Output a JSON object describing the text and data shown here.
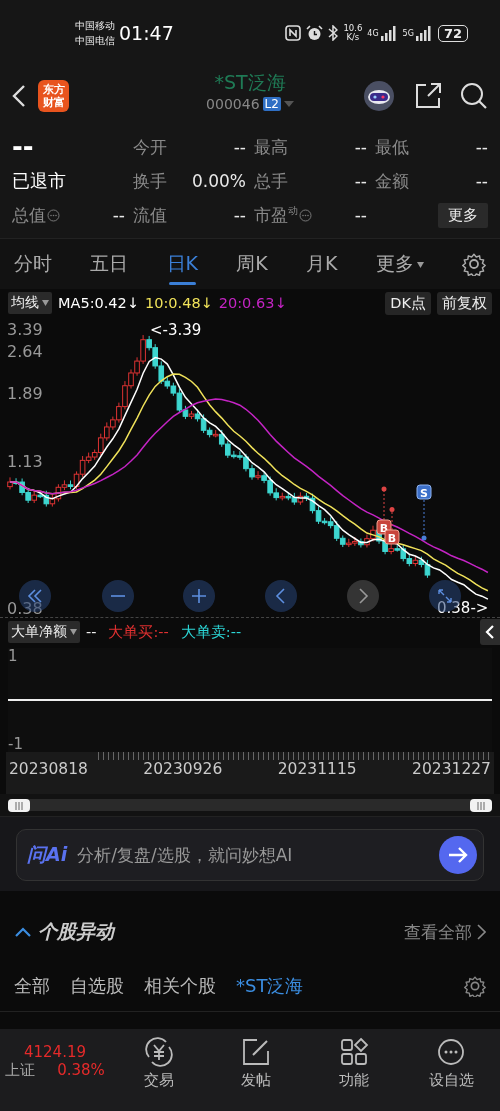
{
  "status_bar": {
    "carriers": [
      "中国移动",
      "中国电信"
    ],
    "time": "01:47",
    "net_speed": [
      "10.6",
      "K/s"
    ],
    "networks": [
      "4G",
      "5G"
    ],
    "battery": "72"
  },
  "header": {
    "logo_lines": [
      "东方",
      "财富"
    ],
    "title": "*ST泛海",
    "code": "000046",
    "level_badge": "L2"
  },
  "quote": {
    "price": "--",
    "status": "已退市",
    "rows": [
      [
        {
          "label": "今开",
          "value": "--"
        },
        {
          "label": "最高",
          "value": "--"
        },
        {
          "label": "最低",
          "value": "--"
        }
      ],
      [
        {
          "label": "换手",
          "value": "0.00%"
        },
        {
          "label": "总手",
          "value": "--"
        },
        {
          "label": "金额",
          "value": "--"
        }
      ]
    ],
    "last_row": {
      "first": {
        "label": "总值",
        "value": "--",
        "info": true
      },
      "fields": [
        {
          "label": "流值",
          "value": "--",
          "info": false
        },
        {
          "label": "市盈$^{动}$",
          "value": "--",
          "info": true
        }
      ],
      "more": "更多"
    }
  },
  "period_tabs": [
    {
      "label": "分时",
      "selected": false
    },
    {
      "label": "五日",
      "selected": false
    },
    {
      "label": "日K",
      "selected": true
    },
    {
      "label": "周K",
      "selected": false
    },
    {
      "label": "月K",
      "selected": false
    },
    {
      "label": "更多",
      "selected": false,
      "dropdown": true
    }
  ],
  "ma_legend": {
    "selector": "均线",
    "items": [
      {
        "text": "MA5:0.42↓",
        "color": "#ffffff"
      },
      {
        "text": "10:0.48↓",
        "color": "#f0e25a"
      },
      {
        "text": "20:0.63↓",
        "color": "#c424c4"
      }
    ],
    "buttons": [
      "DK点",
      "前复权"
    ]
  },
  "chart": {
    "y_labels": [
      "3.39",
      "2.64",
      "1.89",
      "1.13",
      "0.38"
    ],
    "high_label": "<-3.39",
    "low_label": "0.38->",
    "markers": [
      {
        "kind": "buy",
        "text": "B"
      },
      {
        "kind": "buy",
        "text": "B"
      },
      {
        "kind": "sell",
        "text": "S"
      }
    ],
    "zoom_controls": [
      {
        "kind": "fast-back",
        "disabled": false
      },
      {
        "kind": "zoom-out",
        "disabled": false
      },
      {
        "kind": "zoom-in",
        "disabled": false
      },
      {
        "kind": "back",
        "disabled": false
      },
      {
        "kind": "forward",
        "disabled": true
      },
      {
        "kind": "fullscreen",
        "disabled": false
      }
    ]
  },
  "indicator": {
    "selector": "大单净额",
    "value": "--",
    "buy": "大单买:--",
    "sell": "大单卖:--",
    "y_labels": [
      "1",
      "-1"
    ]
  },
  "date_axis": [
    "20230818",
    "20230926",
    "20231115",
    "20231227"
  ],
  "ai_box": {
    "logo": "问Ai",
    "placeholder": "分析/复盘/选股，就问妙想AI"
  },
  "movers": {
    "title": "个股异动",
    "expanded": true,
    "view_all": "查看全部",
    "tabs": [
      {
        "label": "全部",
        "selected": false
      },
      {
        "label": "自选股",
        "selected": false
      },
      {
        "label": "相关个股",
        "selected": false
      },
      {
        "label": "*ST泛海",
        "selected": true
      }
    ]
  },
  "bottom_nav": {
    "index": {
      "value": "4124.19",
      "name": "上证",
      "change": "0.38%"
    },
    "items": [
      {
        "label": "交易",
        "kind": "trade"
      },
      {
        "label": "发帖",
        "kind": "post"
      },
      {
        "label": "功能",
        "kind": "apps"
      },
      {
        "label": "设自选",
        "kind": "more"
      }
    ]
  }
}
